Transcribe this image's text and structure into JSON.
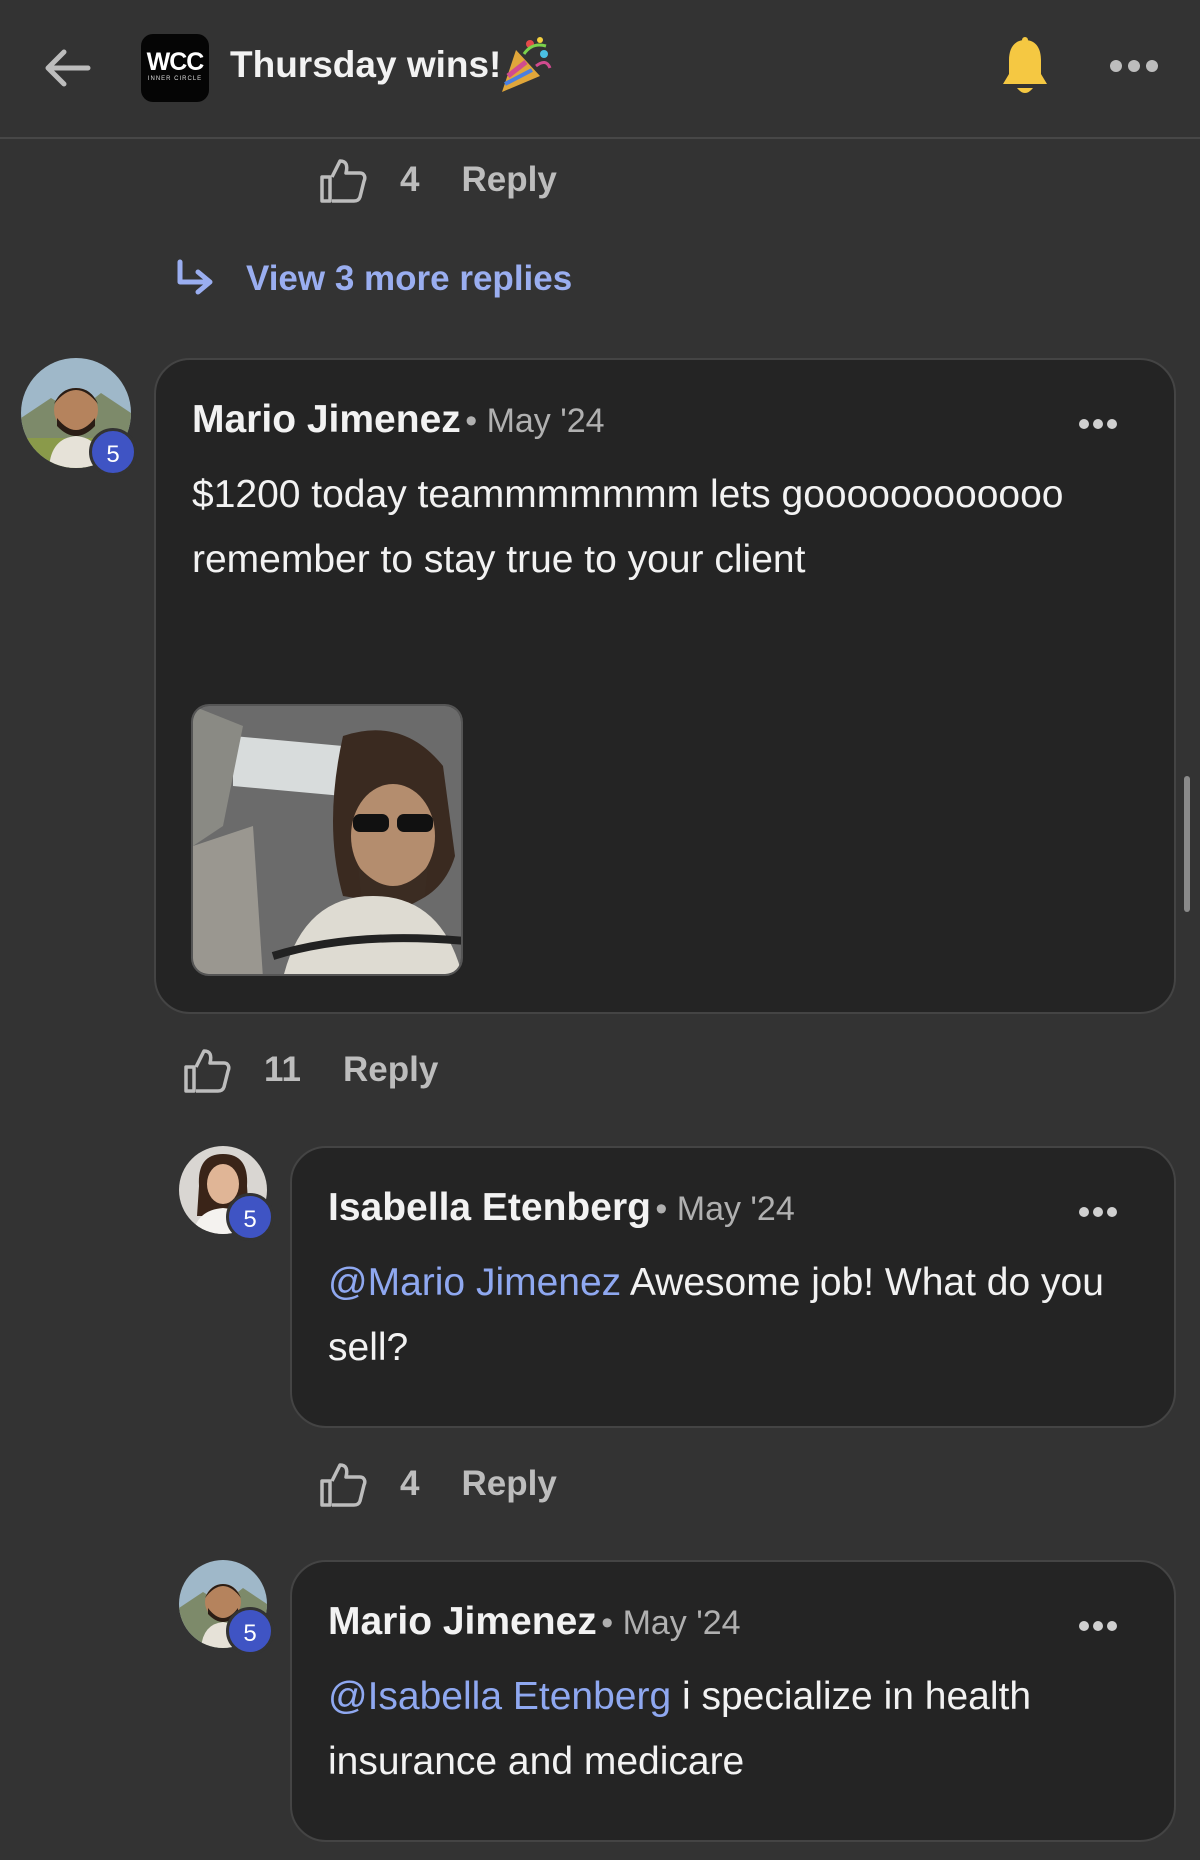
{
  "header": {
    "title": "Thursday wins!",
    "logo_text": "WCC",
    "logo_subtext": "INNER CIRCLE"
  },
  "top_actions": {
    "likes": "4",
    "reply_label": "Reply"
  },
  "view_more": {
    "label": "View 3 more replies"
  },
  "comments": [
    {
      "author": "Mario Jimenez",
      "date": "• May '24",
      "level": "5",
      "text": "$1200 today teammmmmmm lets goooooooooooo remember to stay true to your client",
      "likes": "11",
      "reply_label": "Reply"
    },
    {
      "author": "Isabella Etenberg",
      "date": "• May '24",
      "level": "5",
      "mention": "@Mario Jimenez",
      "text": " Awesome job! What do you sell?",
      "likes": "4",
      "reply_label": "Reply"
    },
    {
      "author": "Mario Jimenez",
      "date": "• May '24",
      "level": "5",
      "mention": "@Isabella Etenberg",
      "text": " i specialize in health insurance and medicare"
    }
  ],
  "colors": {
    "background": "#333333",
    "card": "#242424",
    "mention": "#8fa8f0",
    "badge": "#3f54c4",
    "bell": "#f5c842"
  }
}
